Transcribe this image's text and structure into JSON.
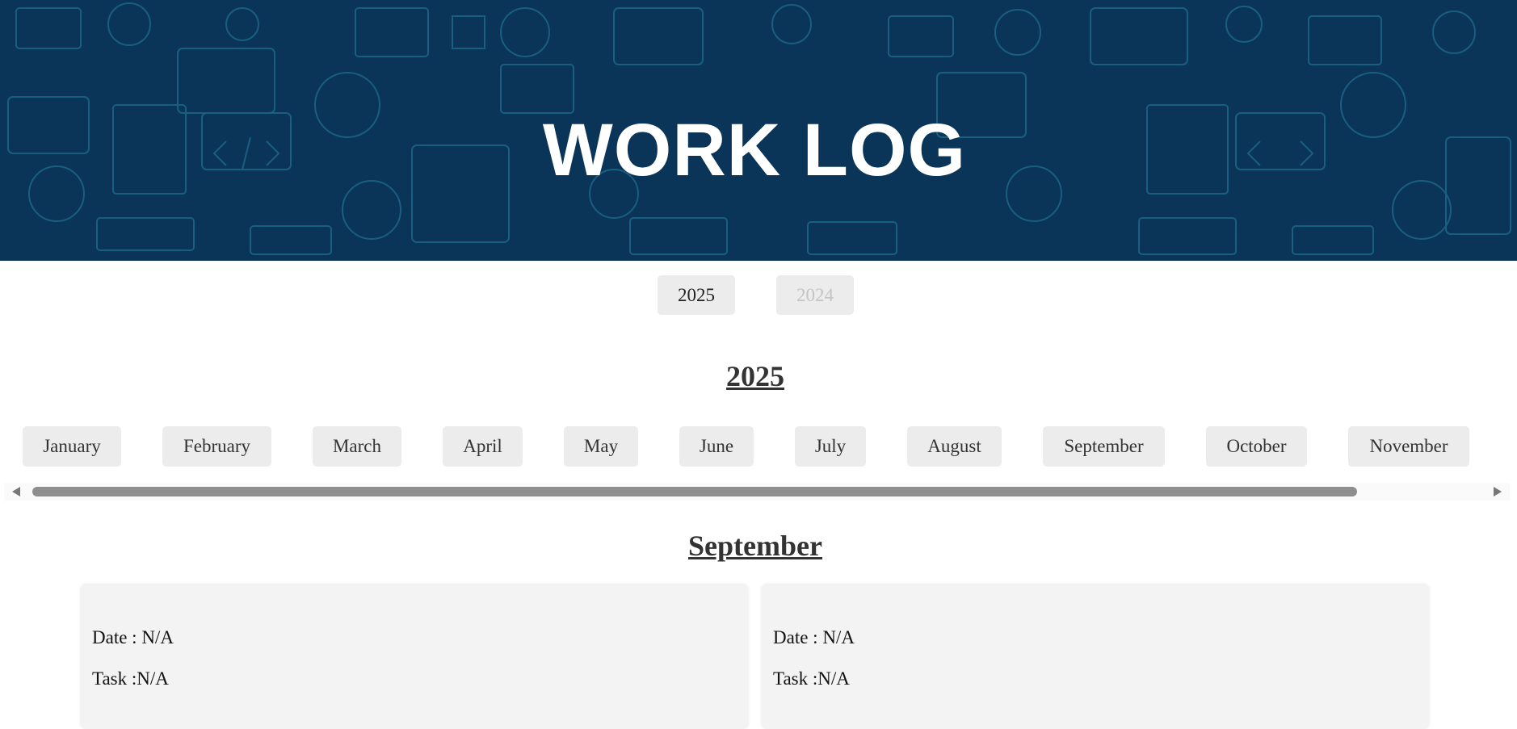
{
  "header": {
    "title": "WORK LOG"
  },
  "years": [
    {
      "label": "2025",
      "state": "active"
    },
    {
      "label": "2024",
      "state": "disabled"
    }
  ],
  "selected_year_heading": "2025",
  "months": [
    "January",
    "February",
    "March",
    "April",
    "May",
    "June",
    "July",
    "August",
    "September",
    "October",
    "November"
  ],
  "selected_month_heading": "September",
  "entries": [
    {
      "date_label": "Date :",
      "date_value": "N/A",
      "task_label": "Task :",
      "task_value": "N/A"
    },
    {
      "date_label": "Date :",
      "date_value": "N/A",
      "task_label": "Task :",
      "task_value": "N/A"
    }
  ],
  "colors": {
    "banner_bg": "#0a3558",
    "banner_pattern": "#1f6d8e",
    "button_bg": "#ececec",
    "card_bg": "#f3f3f3",
    "scroll_thumb": "#8e8e8e"
  }
}
